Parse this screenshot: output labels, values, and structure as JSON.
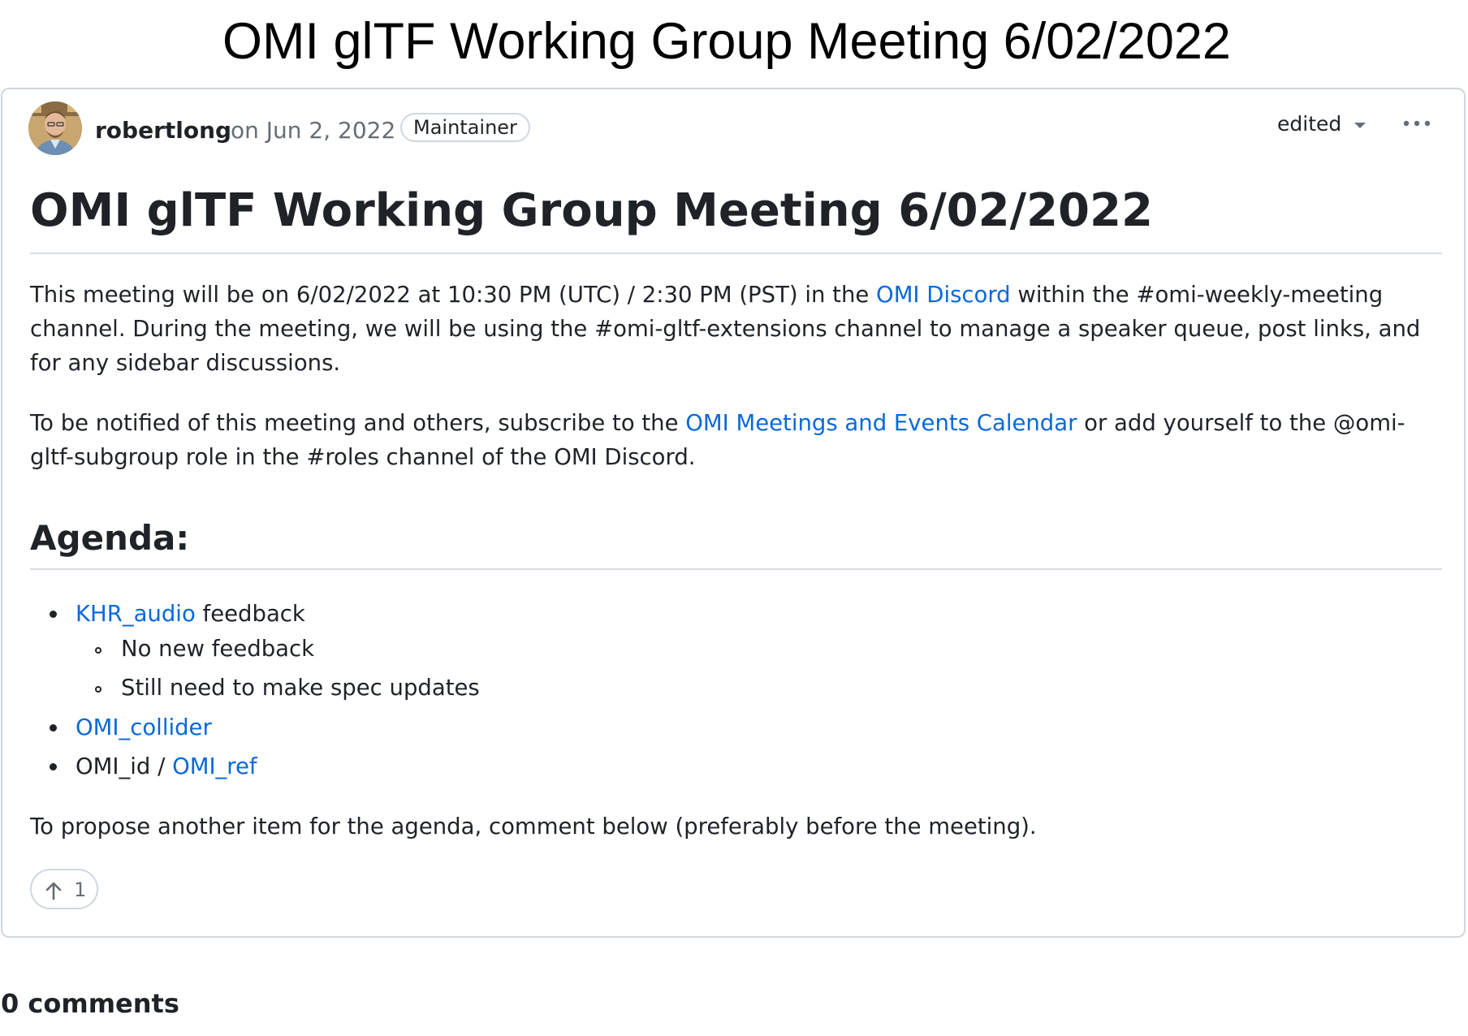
{
  "page": {
    "title": "OMI glTF Working Group Meeting 6/02/2022"
  },
  "post": {
    "author": "robertlong",
    "date": "on Jun 2, 2022",
    "role_badge": "Maintainer",
    "edited_label": "edited",
    "more_icon": "kebab-horizontal-icon",
    "heading": "OMI glTF Working Group Meeting 6/02/2022",
    "paragraph1": {
      "before_link": "This meeting will be on 6/02/2022 at 10:30 PM (UTC) / 2:30 PM (PST) in the ",
      "link": "OMI Discord",
      "after_link": " within the #omi-weekly-meeting channel. During the meeting, we will be using the #omi-gltf-extensions channel to manage a speaker queue, post links, and for any sidebar discussions."
    },
    "paragraph2": {
      "before_link": "To be notified of this meeting and others, subscribe to the ",
      "link": "OMI Meetings and Events Calendar",
      "after_link": " or add yourself to the @omi-gltf-subgroup role in the #roles channel of the OMI Discord."
    },
    "agenda_heading": "Agenda:",
    "agenda": {
      "item1": {
        "link": "KHR_audio",
        "text": " feedback",
        "subitems": [
          "No new feedback",
          "Still need to make spec updates"
        ]
      },
      "item2": {
        "link": "OMI_collider"
      },
      "item3": {
        "text": "OMI_id / ",
        "link": "OMI_ref"
      }
    },
    "closing": "To propose another item for the agenda, comment below (preferably before the meeting).",
    "reaction": {
      "icon": "arrow-up-icon",
      "count": "1"
    }
  },
  "comments": {
    "count_label": "0 comments"
  },
  "colors": {
    "link": "#0969da",
    "text": "#1f2328",
    "muted": "#656d76",
    "border": "#d0d7de"
  }
}
